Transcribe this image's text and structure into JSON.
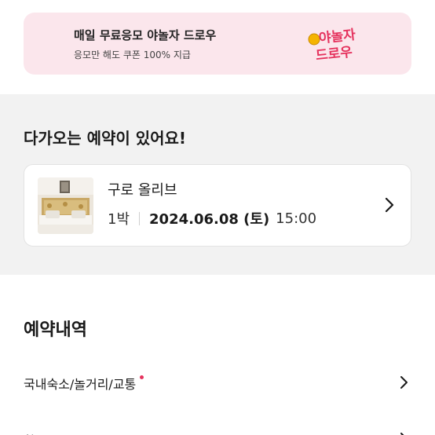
{
  "banner": {
    "title": "매일 무료응모 야놀자 드로우",
    "subtitle": "응모만 해도 쿠폰 100% 지급",
    "logo_text_line1": "야놀자",
    "logo_text_line2": "드로우",
    "logo_color": "#e5335e",
    "background": "#fbe6ec"
  },
  "upcoming": {
    "title": "다가오는 예약이 있어요!",
    "reservation": {
      "hotel_name": "구로 올리브",
      "nights": "1박",
      "date": "2024.06.08 (토)",
      "time": "15:00",
      "icon": "chevron-right-icon"
    }
  },
  "history": {
    "title": "예약내역",
    "items": [
      {
        "label": "국내숙소/놀거리/교통",
        "has_new_dot": true,
        "icon": "chevron-right-icon"
      },
      {
        "label": "항공",
        "has_new_dot": false,
        "icon": "chevron-right-icon"
      }
    ]
  },
  "colors": {
    "accent": "#e5335e",
    "section_gray": "#f2f2f2"
  }
}
